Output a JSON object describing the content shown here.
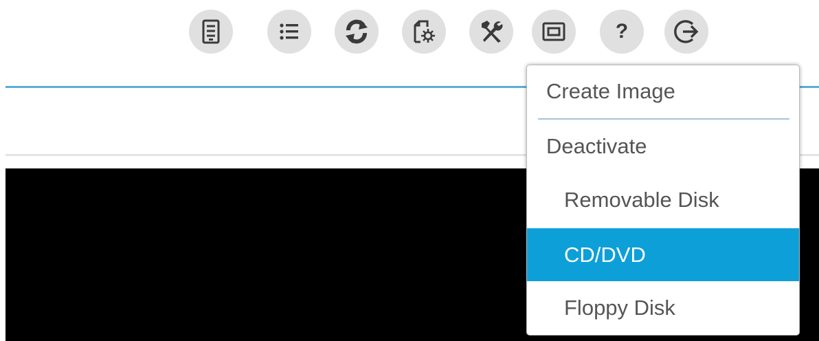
{
  "toolbar": {
    "icons": [
      "server-icon",
      "list-icon",
      "refresh-icon",
      "file-settings-icon",
      "tools-icon",
      "console-window-icon",
      "help-icon",
      "logout-icon"
    ],
    "help_label": "?"
  },
  "menu": {
    "create_image": "Create Image",
    "deactivate": "Deactivate",
    "items": [
      {
        "label": "Removable Disk",
        "selected": false
      },
      {
        "label": "CD/DVD",
        "selected": true
      },
      {
        "label": "Floppy Disk",
        "selected": false
      }
    ]
  },
  "colors": {
    "accent_blue": "#5aaed6",
    "selected_bg": "#0d9fd8",
    "icon_bg": "#e0e0e0",
    "console_bg": "#000000"
  }
}
